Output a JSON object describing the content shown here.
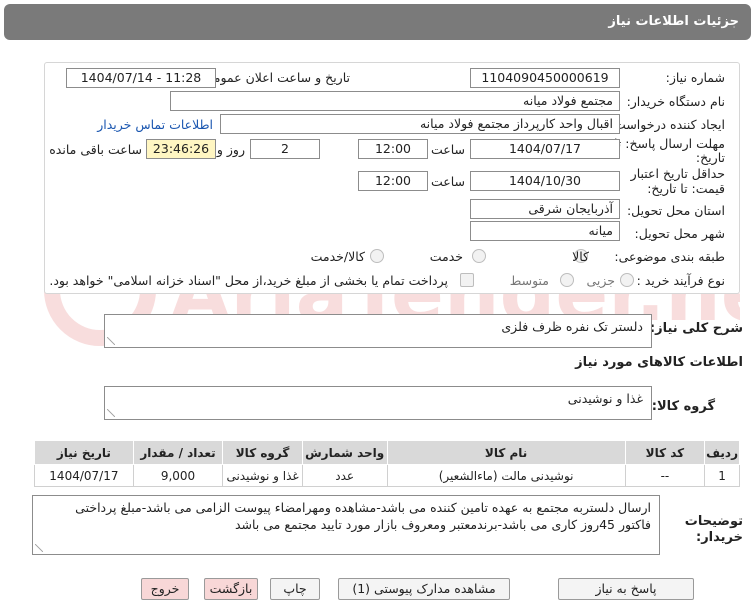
{
  "header": {
    "title": "جزئیات اطلاعات نیاز"
  },
  "form": {
    "need_number_label": "شماره نیاز:",
    "need_number": "1104090450000619",
    "announce_label": "تاریخ و ساعت اعلان عمومی:",
    "announce_value": "1404/07/14 - 11:28",
    "buyer_org_label": "نام دستگاه خریدار:",
    "buyer_org": "مجتمع فولاد میانه",
    "creator_label": "ایجاد کننده درخواست:",
    "creator": "اقبال واحد کارپرداز مجتمع فولاد میانه",
    "contact_link": "اطلاعات تماس خریدار",
    "deadline_label_1": "مهلت ارسال پاسخ: تا",
    "deadline_label_2": "تاریخ:",
    "deadline_date": "1404/07/17",
    "time_label": "ساعت",
    "deadline_time": "12:00",
    "days_value": "2",
    "days_label": "روز و",
    "remaining_time": "23:46:26",
    "remaining_label": "ساعت باقی مانده",
    "validity_label_1": "حداقل تاریخ اعتبار",
    "validity_label_2": "قیمت: تا تاریخ:",
    "validity_date": "1404/10/30",
    "validity_time": "12:00",
    "province_label": "استان محل تحویل:",
    "province": "آذربایجان شرقی",
    "city_label": "شهر محل تحویل:",
    "city": "میانه",
    "category_label": "طبقه بندی موضوعی:",
    "category_options": [
      "کالا",
      "خدمت",
      "کالا/خدمت"
    ],
    "process_label": "نوع فرآیند خرید :",
    "process_options": [
      "جزیی",
      "متوسط"
    ],
    "payment_note": "پرداخت تمام یا بخشی از مبلغ خرید،از محل \"اسناد خزانه اسلامی\" خواهد بود."
  },
  "description": {
    "label": "شرح کلی نیاز:",
    "value": "دلستر تک نفره ظرف فلزی"
  },
  "goods_info": {
    "heading": "اطلاعات کالاهای مورد نیاز",
    "group_label": "گروه کالا:",
    "group_value": "غذا و نوشیدنی"
  },
  "table": {
    "headers": [
      "ردیف",
      "کد کالا",
      "نام کالا",
      "واحد شمارش",
      "گروه کالا",
      "تعداد / مقدار",
      "تاریخ نیاز"
    ],
    "rows": [
      [
        "1",
        "--",
        "نوشیدنی مالت (ماءالشعیر)",
        "عدد",
        "غذا و نوشیدنی",
        "9,000",
        "1404/07/17"
      ]
    ]
  },
  "buyer_notes": {
    "label_1": "توضیحات",
    "label_2": "خریدار:",
    "value": "ارسال دلستربه مجتمع به عهده تامین کننده می باشد-مشاهده ومهرامضاء پیوست الزامی می باشد-مبلغ پرداختی فاکتور 45روز کاری می باشد-برندمعتبر ومعروف بازار مورد تایید مجتمع می باشد"
  },
  "buttons": {
    "reply": "پاسخ به نیاز",
    "attachments": "مشاهده مدارک پیوستی (1)",
    "print": "چاپ",
    "back": "بازگشت",
    "exit": "خروج"
  },
  "watermark": {
    "text": "AriaTender.net"
  },
  "colors": {
    "titlebar": "#7a7a7a",
    "accent_link": "#1a56b0",
    "remaining_bg": "#fff6c2",
    "danger_btn": "#f8d7d7"
  }
}
